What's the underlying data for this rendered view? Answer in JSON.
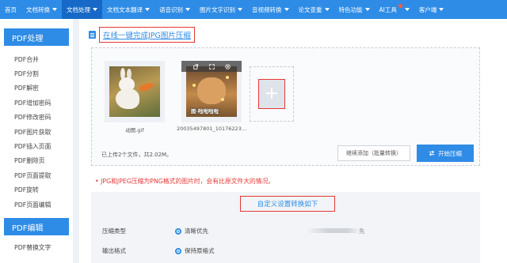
{
  "topnav": {
    "items": [
      {
        "label": "首页",
        "has_caret": false
      },
      {
        "label": "文档转换",
        "has_caret": true
      },
      {
        "label": "文档处理",
        "has_caret": true
      },
      {
        "label": "文档文本翻译",
        "has_caret": true
      },
      {
        "label": "语音识别",
        "has_caret": true
      },
      {
        "label": "图片文字识别",
        "has_caret": true
      },
      {
        "label": "音视频转换",
        "has_caret": true
      },
      {
        "label": "论文查重",
        "has_caret": true
      },
      {
        "label": "特色功能",
        "has_caret": true
      },
      {
        "label": "AI工具",
        "has_caret": true
      },
      {
        "label": "客户端",
        "has_caret": true
      }
    ],
    "active_index": 2,
    "accent": "#2e8ce6",
    "active_color": "#1769c7"
  },
  "sidebar": {
    "section1": "PDF处理",
    "items": [
      "PDF合并",
      "PDF分割",
      "PDF解密",
      "PDF增加密码",
      "PDF修改密码",
      "PDF图片获取",
      "PDF插入页面",
      "PDF删除页",
      "PDF页面提取",
      "PDF旋转",
      "PDF页面编辑"
    ],
    "section2": "PDF编辑",
    "items2": [
      "PDF替换文字"
    ]
  },
  "main": {
    "title": "在线一键完成JPG图片压缩",
    "files": [
      {
        "name": "动图.gif",
        "image": "rabbit-photo"
      },
      {
        "name": "20035497801_10176223...",
        "image": "cat-photo",
        "caption": "图·啦啦啦啦"
      }
    ],
    "upload_info": "已上传2个文件，共2.02M。",
    "continue_button": "继续添加（批量转换）",
    "start_button": "开始压缩",
    "notice": "JPG和JPEG压缩为PNG格式的图片时，会有比原文件大的情况。",
    "settings_title": "自定义设置转换如下",
    "settings": [
      {
        "label": "压缩类型",
        "option": "清晰优先",
        "extra": "先"
      },
      {
        "label": "输出格式",
        "option": "保持原格式"
      }
    ]
  },
  "colors": {
    "alert_red": "#e53935",
    "link_blue": "#2e8ce6"
  }
}
